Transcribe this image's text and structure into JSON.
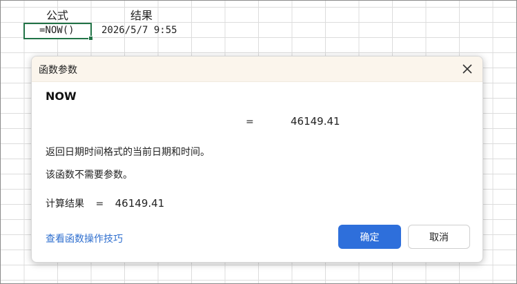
{
  "sheet": {
    "header_formula": "公式",
    "header_result": "结果",
    "formula_cell": "=NOW()",
    "result_cell": "2026/5/7 9:55"
  },
  "dialog": {
    "title": "函数参数",
    "function_name": "NOW",
    "equals": "=",
    "value": "46149.41",
    "description": "返回日期时间格式的当前日期和时间。",
    "no_args_note": "该函数不需要参数。",
    "calc_label": "计算结果",
    "calc_equals": "=",
    "calc_value": "46149.41",
    "tips_link": "查看函数操作技巧",
    "ok_label": "确定",
    "cancel_label": "取消",
    "icons": {
      "close": "close-icon"
    }
  },
  "colors": {
    "accent": "#2e6fdb",
    "link": "#2f6fcf",
    "selection": "#217346",
    "title_bar": "#fbf5ec"
  }
}
